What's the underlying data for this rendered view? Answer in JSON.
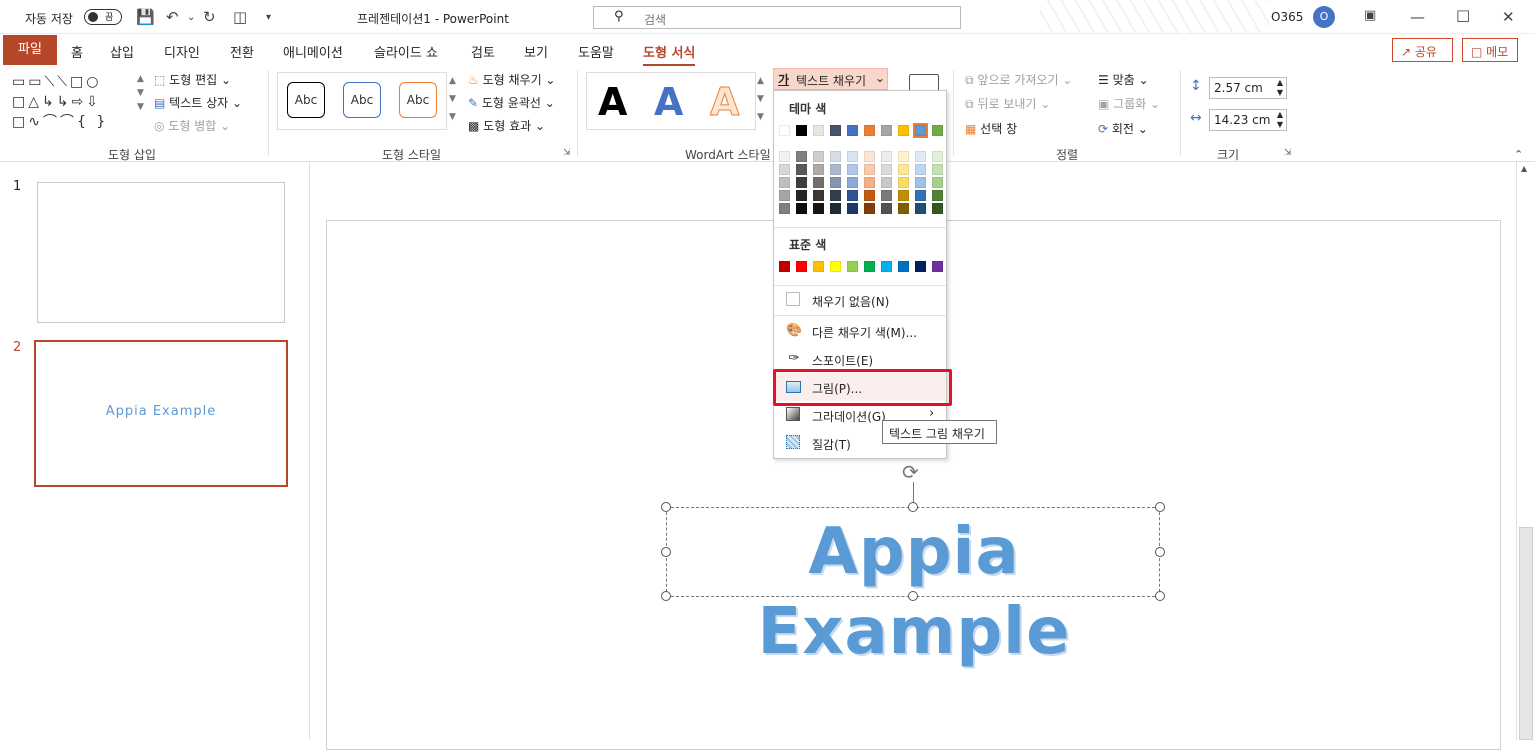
{
  "titlebar": {
    "autosave_label": "자동 저장",
    "autosave_state": "끔",
    "doc_title": "프레젠테이션1  -  PowerPoint",
    "search_placeholder": "검색",
    "account": "O365",
    "avatar_initial": "O"
  },
  "tabs": {
    "file": "파일",
    "items": [
      "홈",
      "삽입",
      "디자인",
      "전환",
      "애니메이션",
      "슬라이드 쇼",
      "검토",
      "보기",
      "도움말"
    ],
    "active": "도형 서식",
    "share": "공유",
    "comments": "메모"
  },
  "ribbon": {
    "insert_shapes": {
      "edit_shape": "도형 편집",
      "text_box": "텍스트 상자",
      "merge_shapes": "도형 병합",
      "group_label": "도형 삽입"
    },
    "shape_styles": {
      "sample": "Abc",
      "fill": "도형 채우기",
      "outline": "도형 윤곽선",
      "effects": "도형 효과",
      "group_label": "도형 스타일"
    },
    "wordart": {
      "sample": "A",
      "text_fill": "텍스트 채우기",
      "text_fill_icon": "가",
      "group_label": "WordArt 스타일"
    },
    "arrange": {
      "bring_forward": "앞으로 가져오기",
      "send_backward": "뒤로 보내기",
      "selection_pane": "선택 창",
      "align": "맞춤",
      "group": "그룹화",
      "rotate": "회전",
      "group_label": "정렬"
    },
    "size": {
      "height": "2.57 cm",
      "width": "14.23 cm",
      "group_label": "크기"
    }
  },
  "slides": [
    {
      "number": "1",
      "text": ""
    },
    {
      "number": "2",
      "text": "Appia Example"
    }
  ],
  "canvas": {
    "textbox_text": "Appia Example"
  },
  "dropdown": {
    "theme_colors_title": "테마 색",
    "standard_colors_title": "표준 색",
    "theme_row": [
      "#ffffff",
      "#000000",
      "#e7e6e6",
      "#44546a",
      "#4472c4",
      "#ed7d31",
      "#a5a5a5",
      "#ffc000",
      "#5b9bd5",
      "#70ad47"
    ],
    "theme_shades": [
      [
        "#f2f2f2",
        "#7f7f7f",
        "#d0cece",
        "#d6dce4",
        "#d9e2f3",
        "#fbe5d5",
        "#ededed",
        "#fff2cc",
        "#deebf6",
        "#e2efd9"
      ],
      [
        "#d8d8d8",
        "#595959",
        "#aeabab",
        "#adb9ca",
        "#b4c6e7",
        "#f7cbac",
        "#dbdbdb",
        "#ffe599",
        "#bdd7ee",
        "#c5e0b3"
      ],
      [
        "#bfbfbf",
        "#3f3f3f",
        "#757070",
        "#8496b0",
        "#8eaadb",
        "#f4b083",
        "#c9c9c9",
        "#ffd965",
        "#9cc3e5",
        "#a8d08d"
      ],
      [
        "#a5a5a5",
        "#262626",
        "#3a3838",
        "#323f4f",
        "#2f5496",
        "#c55a11",
        "#7b7b7b",
        "#bf9000",
        "#2e75b5",
        "#538135"
      ],
      [
        "#7f7f7f",
        "#0c0c0c",
        "#171616",
        "#222a35",
        "#1f3864",
        "#833c0b",
        "#525252",
        "#7f6000",
        "#1f4e79",
        "#375623"
      ]
    ],
    "standard_row": [
      "#c00000",
      "#ff0000",
      "#ffc000",
      "#ffff00",
      "#92d050",
      "#00b050",
      "#00b0f0",
      "#0070c0",
      "#002060",
      "#7030a0"
    ],
    "no_fill": "채우기 없음(N)",
    "more_colors": "다른 채우기 색(M)...",
    "eyedropper": "스포이트(E)",
    "picture": "그림(P)...",
    "gradient": "그라데이션(G)",
    "texture": "질감(T)",
    "tooltip": "텍스트 그림 채우기"
  }
}
